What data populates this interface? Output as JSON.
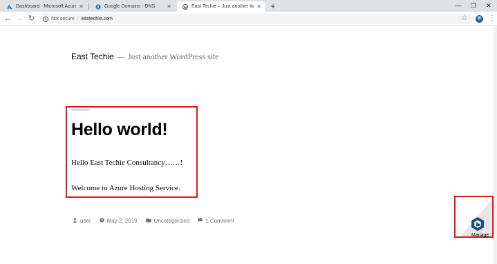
{
  "browser": {
    "tabs": [
      {
        "title": "Dashboard - Microsoft Azure",
        "icon": "azure-icon",
        "active": false
      },
      {
        "title": "Google Domains - DNS",
        "icon": "google-domains-icon",
        "active": false
      },
      {
        "title": "East Techie – Just another WordPre",
        "icon": "wordpress-icon",
        "active": true
      }
    ],
    "new_tab_symbol": "+",
    "window_controls": {
      "minimize": "—",
      "maximize": "❐",
      "close": "✕"
    },
    "nav": {
      "back": "←",
      "forward": "→",
      "reload": "↻"
    },
    "address_bar": {
      "security_label": "Not secure",
      "url": "eastechie.com"
    },
    "bookmark_symbol": "☆",
    "menu_symbol": "⋮"
  },
  "site": {
    "title": "East Techie",
    "separator": "—",
    "tagline": "Just another WordPress site"
  },
  "post": {
    "title": "Hello world!",
    "paragraphs": [
      "Hello East Techie Consultancy……!",
      "Welcome to Azure Hosting Service."
    ],
    "meta": {
      "author": "user",
      "date": "May 2, 2019",
      "category": "Uncategorized",
      "comments": "1 Comment"
    }
  },
  "manage_widget": {
    "label": "Manage"
  },
  "colors": {
    "highlight": "#e0161f",
    "tabstrip": "#dee1e6",
    "wordpress_blue": "#21759b",
    "manage_logo": "#1f4e79"
  }
}
